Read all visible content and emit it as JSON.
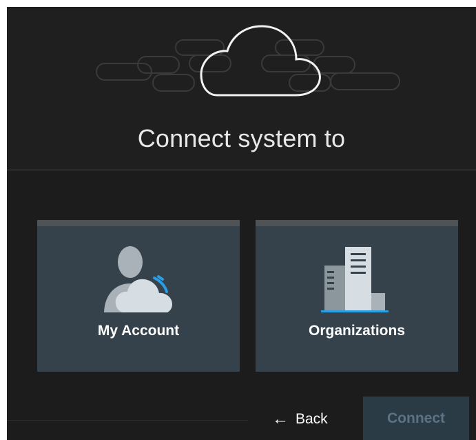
{
  "dialog": {
    "title": "Connect system to"
  },
  "options": [
    {
      "label": "My Account",
      "icon": "user-cloud-icon"
    },
    {
      "label": "Organizations",
      "icon": "buildings-icon"
    }
  ],
  "footer": {
    "back_label": "Back",
    "back_icon": "arrow-left-icon",
    "connect_label": "Connect",
    "connect_enabled": false
  },
  "colors": {
    "dialog_bg": "#1c1c1c",
    "card_bg": "#35424b",
    "accent_blue": "#2a9ee2",
    "connect_disabled_bg": "#2a3b46",
    "connect_disabled_text": "#5c7383"
  }
}
